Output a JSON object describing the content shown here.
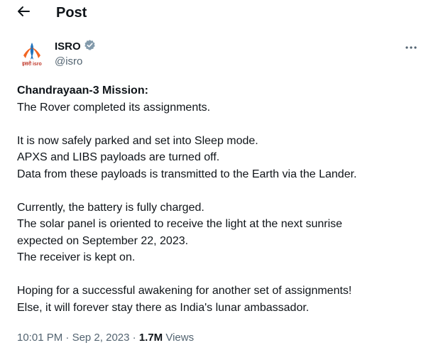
{
  "header": {
    "title": "Post",
    "back_icon": "arrow-left-icon"
  },
  "author": {
    "name": "ISRO",
    "handle": "@isro",
    "verified_icon": "verified-badge-icon",
    "avatar_text": "इसरो isro"
  },
  "more_icon": "more-horizontal-icon",
  "post": {
    "title": "Chandrayaan-3 Mission:",
    "line1": "The Rover completed its assignments.",
    "line2": "It is now safely parked and set into Sleep mode.",
    "line3": "APXS and LIBS payloads are turned off.",
    "line4": "Data from these payloads is transmitted to the Earth via the Lander.",
    "line5": "Currently, the battery is fully charged.",
    "line6": "The solar panel is oriented to receive the light at the next sunrise expected on September 22, 2023.",
    "line7": "The receiver is kept on.",
    "line8": "Hoping for a successful awakening for another set of assignments!",
    "line9": "Else, it will forever stay there as India's lunar ambassador."
  },
  "meta": {
    "time": "10:01 PM",
    "date": "Sep 2, 2023",
    "separator": "·",
    "views_count": "1.7M",
    "views_label": "Views"
  },
  "colors": {
    "text_primary": "#0f1419",
    "text_secondary": "#536471",
    "verified": "#829aab",
    "logo_orange": "#f26522",
    "logo_blue": "#1e73be"
  }
}
